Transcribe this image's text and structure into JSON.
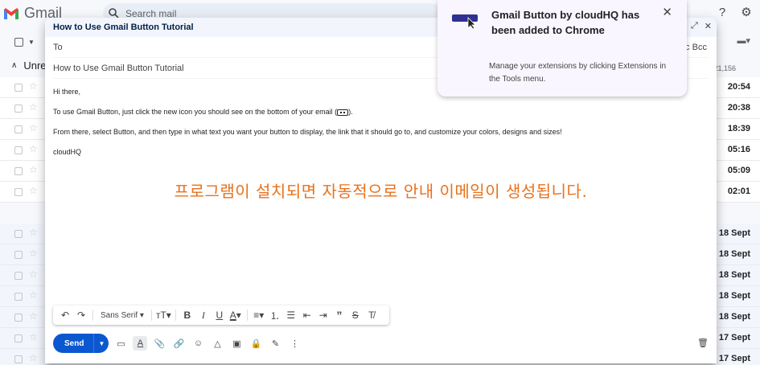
{
  "gmail": {
    "logo_text": "Gmail",
    "search_placeholder": "Search mail",
    "unread_label": "Unre",
    "count_text": "21,156",
    "row_dates": [
      "20:54",
      "20:38",
      "18:39",
      "05:16",
      "05:09",
      "02:01",
      "18 Sept",
      "18 Sept",
      "18 Sept",
      "18 Sept",
      "18 Sept",
      "17 Sept",
      "17 Sept"
    ]
  },
  "compose": {
    "window_title": "How to Use Gmail Button Tutorial",
    "to_label": "To",
    "cc_bcc": "c Bcc",
    "subject": "How to Use Gmail Button Tutorial",
    "greeting": "Hi there,",
    "line1_a": "To use Gmail Button, just click the new icon you should see on the bottom of your email (",
    "line1_b": ").",
    "line2": "From there, select Button, and then type in what text you want your button to display, the link that it should go to, and customize your colors, designs and sizes!",
    "signature": "cloudHQ",
    "overlay_caption": "프로그램이 설치되면 자동적으로 안내 이메일이 생성됩니다.",
    "font_name": "Sans Serif",
    "send_label": "Send"
  },
  "extension_popup": {
    "title": "Gmail Button by cloudHQ has been added to Chrome",
    "description": "Manage your extensions by clicking Extensions in the Tools menu.",
    "close_glyph": "✕"
  },
  "colors": {
    "send_blue": "#0b57d0",
    "caption_orange": "#e8711c",
    "popup_bg": "#faf6ff"
  }
}
